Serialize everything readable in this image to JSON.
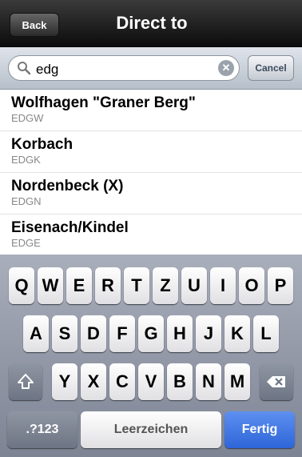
{
  "nav": {
    "back_label": "Back",
    "title": "Direct to"
  },
  "search": {
    "value": "edg",
    "clear_symbol": "✕",
    "cancel_label": "Cancel"
  },
  "results": [
    {
      "name": "Wolfhagen \"Graner Berg\"",
      "code": "EDGW"
    },
    {
      "name": "Korbach",
      "code": "EDGK"
    },
    {
      "name": "Nordenbeck (X)",
      "code": "EDGN"
    },
    {
      "name": "Eisenach/Kindel",
      "code": "EDGE"
    }
  ],
  "keyboard": {
    "row1": [
      "Q",
      "W",
      "E",
      "R",
      "T",
      "Z",
      "U",
      "I",
      "O",
      "P"
    ],
    "row2": [
      "A",
      "S",
      "D",
      "F",
      "G",
      "H",
      "J",
      "K",
      "L"
    ],
    "row3": [
      "Y",
      "X",
      "C",
      "V",
      "B",
      "N",
      "M"
    ],
    "numbers_label": ".?123",
    "space_label": "Leerzeichen",
    "return_label": "Fertig"
  },
  "colors": {
    "return_key": "#2e66d8",
    "nav_bar": "#1a1a1a"
  }
}
